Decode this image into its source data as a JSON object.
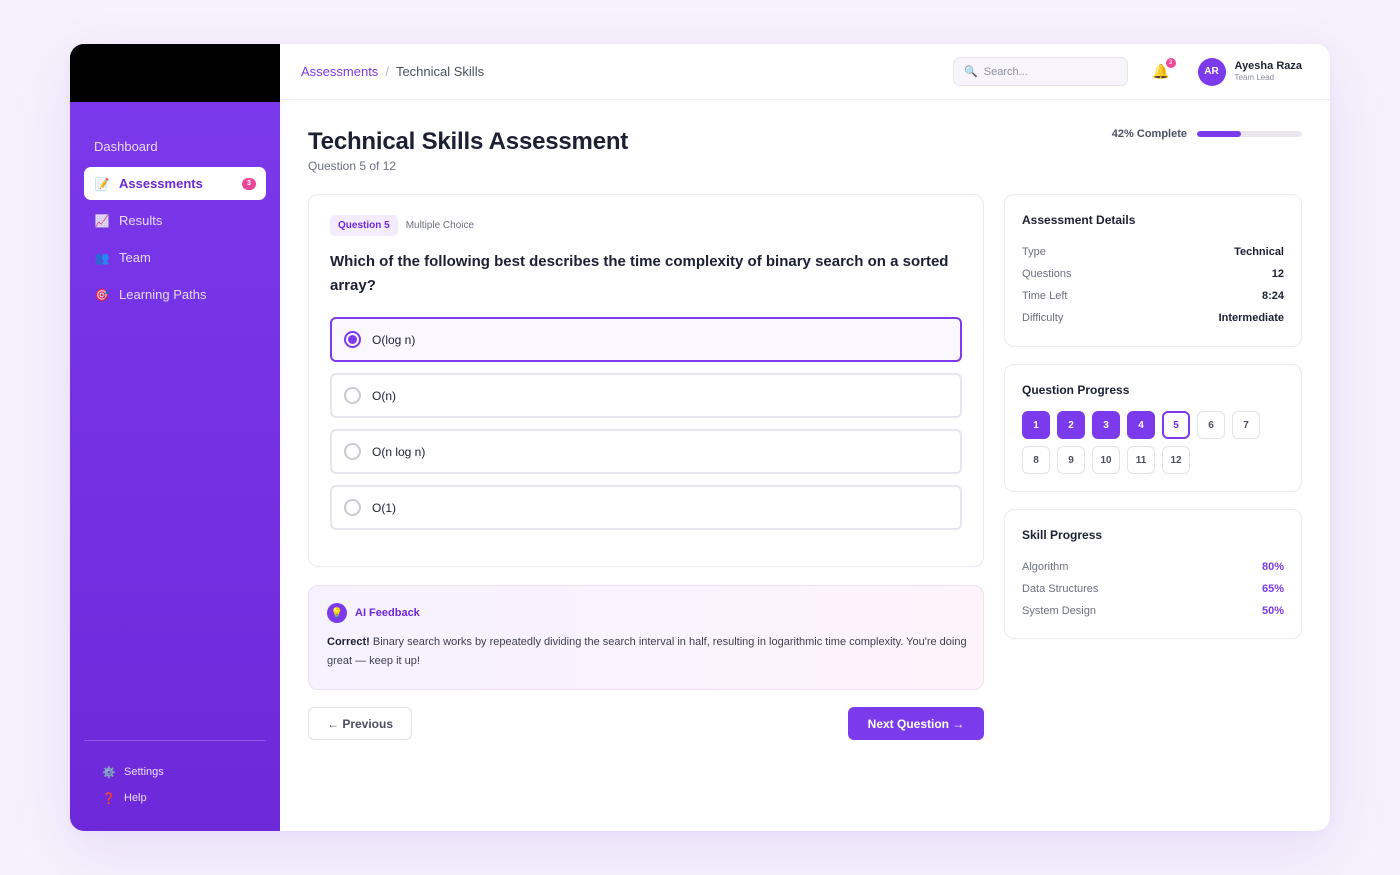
{
  "sidebar": {
    "items": [
      {
        "label": "Dashboard",
        "icon": "none",
        "active": false
      },
      {
        "label": "Assessments",
        "icon": "memo-icon",
        "active": true,
        "badge": "3"
      },
      {
        "label": "Results",
        "icon": "chart-icon",
        "active": false
      },
      {
        "label": "Team",
        "icon": "people-icon",
        "active": false
      },
      {
        "label": "Learning Paths",
        "icon": "target-icon",
        "active": false
      }
    ],
    "bottom": [
      {
        "label": "Settings",
        "icon": "gear-icon"
      },
      {
        "label": "Help",
        "icon": "question-icon"
      }
    ]
  },
  "header": {
    "breadcrumb": {
      "parent": "Assessments",
      "separator": "/",
      "current": "Technical Skills"
    },
    "search": {
      "placeholder": "Search..."
    },
    "notifications": {
      "count": "3"
    },
    "user": {
      "initials": "AR",
      "name": "Ayesha Raza",
      "role": "Team Lead"
    }
  },
  "page": {
    "title": "Technical Skills Assessment",
    "subtitle": "Question 5 of 12",
    "progress_label": "42% Complete",
    "progress_value": 0.42
  },
  "question": {
    "tag": "Question 5",
    "type": "Multiple Choice",
    "text": "Which of the following best describes the time complexity of binary search on a sorted array?",
    "options": [
      {
        "label": "O(log n)",
        "selected": true
      },
      {
        "label": "O(n)",
        "selected": false
      },
      {
        "label": "O(n log n)",
        "selected": false
      },
      {
        "label": "O(1)",
        "selected": false
      }
    ]
  },
  "feedback": {
    "title": "AI Feedback",
    "icon": "lightbulb-icon",
    "lead": "Correct!",
    "body": " Binary search works by repeatedly dividing the search interval in half, resulting in logarithmic time complexity. You're doing great — keep it up!"
  },
  "nav_buttons": {
    "previous": "← Previous",
    "next": "Next Question →"
  },
  "details": {
    "title": "Assessment Details",
    "rows": [
      {
        "key": "Type",
        "value": "Technical"
      },
      {
        "key": "Questions",
        "value": "12"
      },
      {
        "key": "Time Left",
        "value": "8:24"
      },
      {
        "key": "Difficulty",
        "value": "Intermediate"
      }
    ]
  },
  "question_progress": {
    "title": "Question Progress",
    "items": [
      {
        "n": "1",
        "state": "done"
      },
      {
        "n": "2",
        "state": "done"
      },
      {
        "n": "3",
        "state": "done"
      },
      {
        "n": "4",
        "state": "done"
      },
      {
        "n": "5",
        "state": "current"
      },
      {
        "n": "6",
        "state": "todo"
      },
      {
        "n": "7",
        "state": "todo"
      },
      {
        "n": "8",
        "state": "todo"
      },
      {
        "n": "9",
        "state": "todo"
      },
      {
        "n": "10",
        "state": "todo"
      },
      {
        "n": "11",
        "state": "todo"
      },
      {
        "n": "12",
        "state": "todo"
      }
    ]
  },
  "skills": {
    "title": "Skill Progress",
    "rows": [
      {
        "key": "Algorithm",
        "value": "80%"
      },
      {
        "key": "Data Structures",
        "value": "65%"
      },
      {
        "key": "System Design",
        "value": "50%"
      }
    ]
  },
  "colors": {
    "accent": "#7c3aed",
    "badge": "#ec4899",
    "background": "#f6f1fb"
  }
}
